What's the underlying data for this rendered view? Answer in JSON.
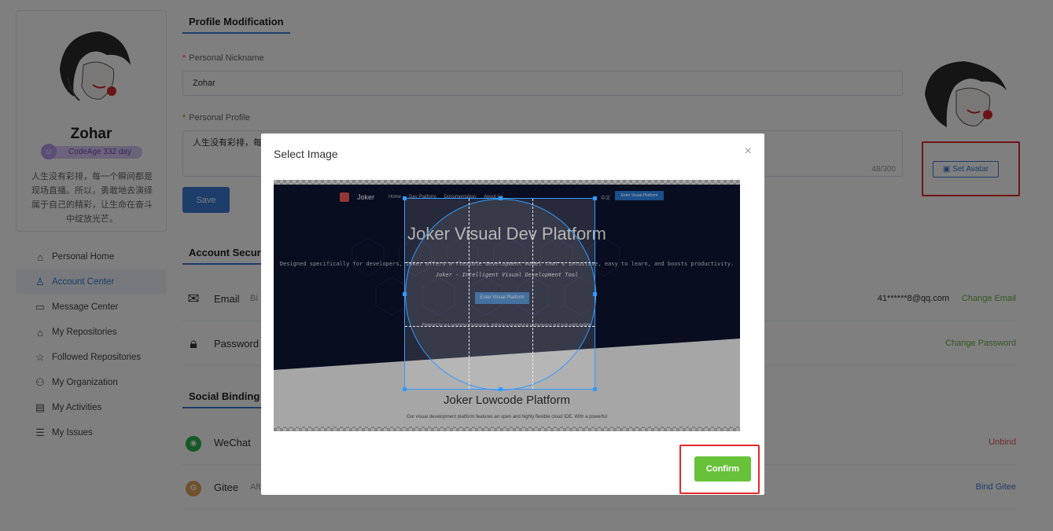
{
  "profile_card": {
    "name": "Zohar",
    "code_age": "CodeAge 332 day",
    "bio": "人生没有彩排，每一个瞬间都是现场直播。所以，勇敢地去演绎属于自己的精彩，让生命在奋斗中绽放光芒。"
  },
  "nav": {
    "items": [
      {
        "label": "Personal Home",
        "icon": "home-icon"
      },
      {
        "label": "Account Center",
        "icon": "user-icon"
      },
      {
        "label": "Message Center",
        "icon": "message-icon"
      },
      {
        "label": "My Repositories",
        "icon": "repository-icon"
      },
      {
        "label": "Followed Repositories",
        "icon": "followed-icon"
      },
      {
        "label": "My Organization",
        "icon": "organization-icon"
      },
      {
        "label": "My Activities",
        "icon": "activity-icon"
      },
      {
        "label": "My Issues",
        "icon": "issues-icon"
      }
    ]
  },
  "profile_modification": {
    "title": "Profile Modification",
    "nickname_label": "Personal Nickname",
    "nickname_value": "Zohar",
    "profile_label": "Personal Profile",
    "profile_value": "人生没有彩排，每",
    "profile_counter": "48/300",
    "save_label": "Save",
    "set_avatar_label": "Set Avatar"
  },
  "account_security": {
    "title": "Account Securi",
    "email_label": "Email",
    "email_desc": "Bi",
    "email_value": "41******8@qq.com",
    "email_action": "Change Email",
    "password_label": "Password",
    "password_action": "Change Password"
  },
  "social_binding": {
    "title": "Social Binding",
    "wechat_label": "WeChat",
    "wechat_action": "Unbind",
    "gitee_label": "Gitee",
    "gitee_desc": "Aft",
    "gitee_action": "Bind Gitee"
  },
  "modal": {
    "title": "Select Image",
    "close": "×",
    "confirm_label": "Confirm",
    "preview": {
      "brand": "Joker",
      "nav_home": "Home",
      "nav_dev": "Dev Platform",
      "nav_docs": "Documentation",
      "nav_about": "About Us",
      "lang": "中文",
      "enter_top": "Enter Visual Platform",
      "headline": "Joker Visual Dev Platform",
      "description": "Designed specifically for developers, Joker offers a flexible development model that's intuitive, easy to learn, and boosts productivity.",
      "tagline": "Joker - Intelligent Visual Development Tool",
      "enter_button": "Enter Visual Platform",
      "powered": "Powered by our proprietary framework, delivering exceptional performance and rock-solid stability",
      "lowcode_title": "Joker Lowcode Platform",
      "lowcode_desc": "Our visual development platform features an open and highly flexible cloud IDE. With a powerful"
    }
  },
  "colors": {
    "primary": "#3a7bd5",
    "confirm": "#67c23a",
    "highlight": "#e8262a",
    "change_link": "#67b342",
    "unbind": "#e25454"
  }
}
